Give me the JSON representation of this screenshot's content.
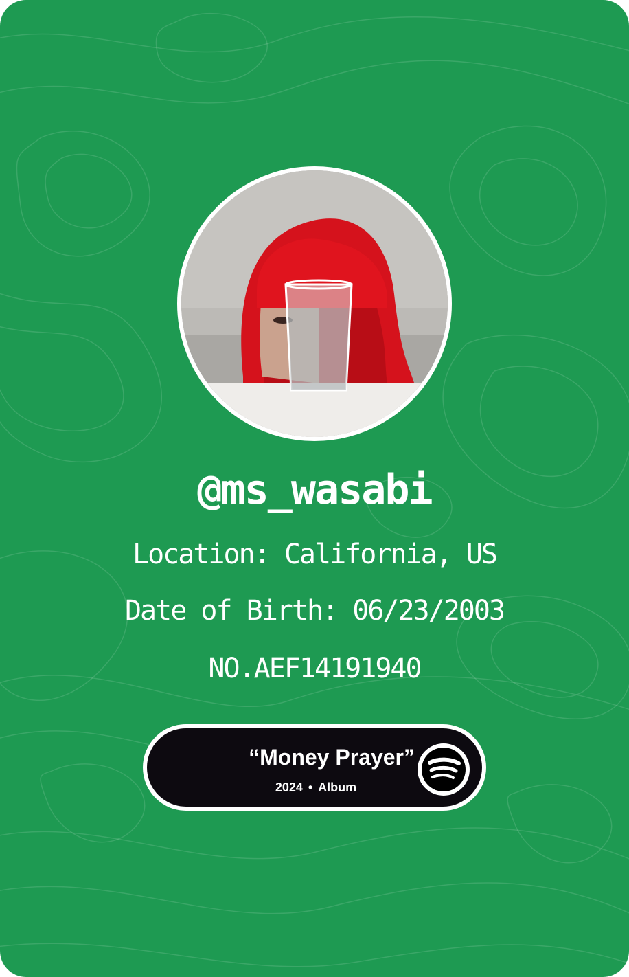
{
  "profile": {
    "username": "@ms_wasabi",
    "location": "Location: California, US",
    "dob": "Date of Birth: 06/23/2003",
    "id_number": "NO.AEF14191940"
  },
  "track": {
    "title": "“Money Prayer”",
    "year": "2024",
    "separator": "•",
    "type": "Album"
  },
  "icons": {
    "player_icon": "spotify-logo-icon"
  },
  "colors": {
    "card_background": "#1e9a52",
    "player_background": "#0d0a10",
    "text": "#ffffff"
  }
}
